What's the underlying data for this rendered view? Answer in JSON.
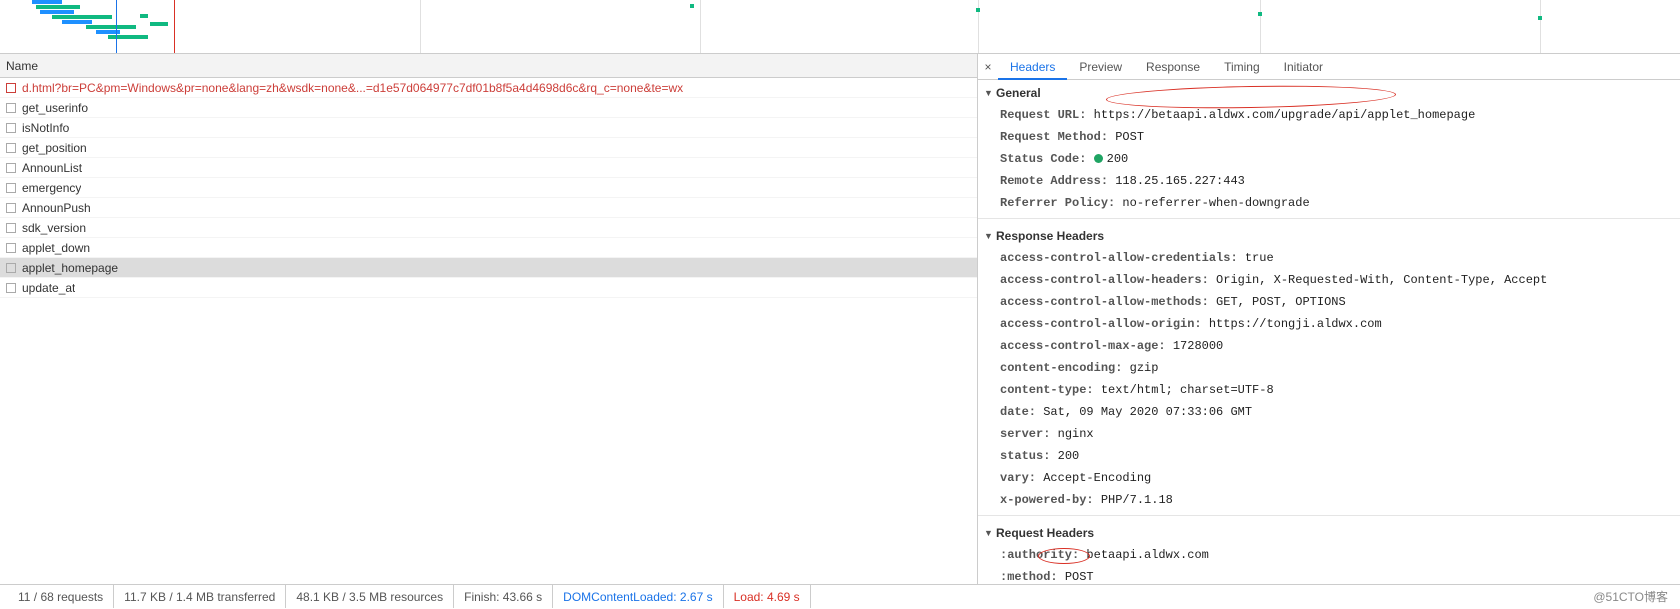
{
  "list_header": "Name",
  "requests": [
    {
      "name": "d.html?br=PC&pm=Windows&pr=none&lang=zh&wsdk=none&...=d1e57d064977c7df01b8f5a4d4698d6c&rq_c=none&te=wx",
      "red": true
    },
    {
      "name": "get_userinfo"
    },
    {
      "name": "isNotInfo"
    },
    {
      "name": "get_position"
    },
    {
      "name": "AnnounList"
    },
    {
      "name": "emergency"
    },
    {
      "name": "AnnounPush"
    },
    {
      "name": "sdk_version"
    },
    {
      "name": "applet_down"
    },
    {
      "name": "applet_homepage",
      "selected": true
    },
    {
      "name": "update_at"
    }
  ],
  "tabs": {
    "close": "×",
    "items": [
      "Headers",
      "Preview",
      "Response",
      "Timing",
      "Initiator"
    ],
    "active": 0
  },
  "sections": {
    "general_title": "General",
    "response_headers_title": "Response Headers",
    "request_headers_title": "Request Headers"
  },
  "general": {
    "request_url": {
      "k": "Request URL:",
      "v": "https://betaapi.aldwx.com/upgrade/api/applet_homepage"
    },
    "request_method": {
      "k": "Request Method:",
      "v": "POST"
    },
    "status_code": {
      "k": "Status Code:",
      "v": "200"
    },
    "remote_address": {
      "k": "Remote Address:",
      "v": "118.25.165.227:443"
    },
    "referrer_policy": {
      "k": "Referrer Policy:",
      "v": "no-referrer-when-downgrade"
    }
  },
  "response_headers": [
    {
      "k": "access-control-allow-credentials:",
      "v": "true"
    },
    {
      "k": "access-control-allow-headers:",
      "v": "Origin, X-Requested-With, Content-Type, Accept"
    },
    {
      "k": "access-control-allow-methods:",
      "v": "GET, POST, OPTIONS"
    },
    {
      "k": "access-control-allow-origin:",
      "v": "https://tongji.aldwx.com"
    },
    {
      "k": "access-control-max-age:",
      "v": "1728000"
    },
    {
      "k": "content-encoding:",
      "v": "gzip"
    },
    {
      "k": "content-type:",
      "v": "text/html; charset=UTF-8"
    },
    {
      "k": "date:",
      "v": "Sat, 09 May 2020 07:33:06 GMT"
    },
    {
      "k": "server:",
      "v": "nginx"
    },
    {
      "k": "status:",
      "v": "200"
    },
    {
      "k": "vary:",
      "v": "Accept-Encoding"
    },
    {
      "k": "x-powered-by:",
      "v": "PHP/7.1.18"
    }
  ],
  "request_headers": [
    {
      "k": ":authority:",
      "v": "betaapi.aldwx.com"
    },
    {
      "k": ":method:",
      "v": "POST"
    }
  ],
  "status_bar": {
    "requests": "11 / 68 requests",
    "transferred": "11.7 KB / 1.4 MB transferred",
    "resources": "48.1 KB / 3.5 MB resources",
    "finish": "Finish: 43.66 s",
    "dom": "DOMContentLoaded: 2.67 s",
    "load": "Load: 4.69 s"
  },
  "watermark": "@51CTO博客"
}
